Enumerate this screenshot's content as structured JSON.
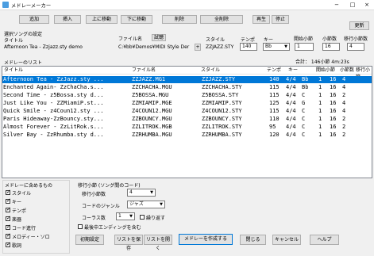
{
  "window": {
    "title": "メドレーメーカー"
  },
  "toolbar": {
    "add": "追加",
    "insert": "挿入",
    "move_up": "上に移動",
    "move_down": "下に移動",
    "delete": "削除",
    "delete_all": "全削除",
    "play": "再生",
    "stop": "停止",
    "update": "更新"
  },
  "song_settings": {
    "title": "選択ソングの設定",
    "title_label": "タイトル",
    "title_value": "Afternoon Tea - Zzjazz.sty demo",
    "file_label": "ファイル名",
    "test_button": "試聴",
    "file_value": "C:¥bb¥Demos¥MIDI Style Der",
    "plus_button": "+",
    "style_label": "スタイル",
    "style_value": "ZZJAZZ.STY",
    "tempo_label": "テンポ",
    "tempo_value": "140",
    "key_label": "キー",
    "key_value": "Bb",
    "start_bar_label": "開始小節",
    "start_bar_value": "1",
    "bars_label": "小節数",
    "bars_value": "16",
    "transition_label": "移行小節数",
    "transition_value": "4"
  },
  "list": {
    "title": "メドレーのリスト",
    "total": "合計： 146小節 4m:23s",
    "headers": [
      "タイトル",
      "ファイル名",
      "スタイル",
      "テンポ",
      "キー",
      "",
      "開始小節",
      "小節数",
      "移行小節"
    ],
    "rows": [
      [
        "Afternoon Tea - ZzJazz.sty ...",
        "ZZJAZZ.MG1",
        "ZZJAZZ.STY",
        "140",
        "4/4",
        "Bb",
        "1",
        "16",
        "4"
      ],
      [
        "Enchanted Again- ZzChaCha.s...",
        "ZZCHACHA.MGU",
        "ZZCHACHA.STY",
        "115",
        "4/4",
        "Bb",
        "1",
        "16",
        "4"
      ],
      [
        "Second Time - z5Bossa.sty d...",
        "Z5BOSSA.MGU",
        "Z5BOSSA.STY",
        "115",
        "4/4",
        "C",
        "1",
        "16",
        "2"
      ],
      [
        "Just Like You - ZZMiamiP.st...",
        "ZZMIAMIP.MGE",
        "ZZMIAMIP.STY",
        "125",
        "4/4",
        "G",
        "1",
        "16",
        "4"
      ],
      [
        "Quick Smile - z4Coun12.sty ...",
        "Z4COUN12.MGU",
        "Z4COUN12.STY",
        "115",
        "4/4",
        "C",
        "1",
        "16",
        "4"
      ],
      [
        "Paris Hideaway-ZzBouncy.sty...",
        "ZZBOUNCY.MGU",
        "ZZBOUNCY.STY",
        "110",
        "4/4",
        "C",
        "1",
        "16",
        "2"
      ],
      [
        "Almost Forever - ZzLitRok.s...",
        "ZZLITROK.MGB",
        "ZZLITROK.STY",
        "95",
        "4/4",
        "C",
        "1",
        "16",
        "2"
      ],
      [
        "Silver Bay - ZzRhumba.sty d...",
        "ZZRHUMBA.MGU",
        "ZZRHUMBA.STY",
        "120",
        "4/4",
        "C",
        "1",
        "16",
        "2"
      ]
    ]
  },
  "medley_include": {
    "title": "メドレーに含めるもの",
    "items": [
      {
        "label": "スタイル",
        "checked": true
      },
      {
        "label": "キー",
        "checked": true
      },
      {
        "label": "テンポ",
        "checked": true
      },
      {
        "label": "楽器",
        "checked": true
      },
      {
        "label": "コード進行",
        "checked": true
      },
      {
        "label": "メロディー・ソロ",
        "checked": true
      },
      {
        "label": "歌詞",
        "checked": true
      }
    ]
  },
  "transition": {
    "title": "移行小節 (ソング間のコード)",
    "bars_label": "移行小節数",
    "bars_value": "4",
    "genre_label": "コードのジャンル",
    "genre_value": "ジャズ",
    "chorus_label": "コーラス数",
    "chorus_value": "1",
    "repeat_label": "繰り返す",
    "ending_label": "最後中エンディングを含む"
  },
  "bottom_buttons": {
    "initial": "初期設定",
    "save_list": "リストを保存",
    "open_list": "リストを開く",
    "make_medley": "メドレーを作成する",
    "close": "閉じる",
    "cancel": "キャンセル",
    "help": "ヘルプ"
  }
}
